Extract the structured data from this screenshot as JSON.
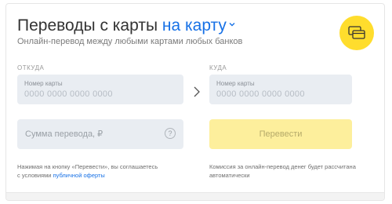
{
  "header": {
    "title_main": "Переводы с карты",
    "title_accent": "на карту",
    "subtitle": "Онлайн-перевод между любыми картами любых банков"
  },
  "icons": {
    "badge": "cards-icon",
    "dropdown": "chevron-down-icon",
    "arrow": "chevron-right-icon",
    "help": "help-icon"
  },
  "from": {
    "section_label": "ОТКУДА",
    "card_label": "Номер карты",
    "card_placeholder": "0000 0000 0000 0000"
  },
  "to": {
    "section_label": "КУДА",
    "card_label": "Номер карты",
    "card_placeholder": "0000 0000 0000 0000"
  },
  "amount": {
    "placeholder": "Сумма перевода, ₽",
    "help_glyph": "?"
  },
  "submit": {
    "label": "Перевести"
  },
  "notes": {
    "left_line1": "Нажимая на кнопку «Перевести», вы соглашаетесь",
    "left_line2_prefix": "с условиями",
    "left_link": "публичной оферты",
    "right_line1": "Комиссия за онлайн-перевод денег будет рассчитана",
    "right_line2": "автоматически"
  },
  "colors": {
    "accent": "#1771e6",
    "brand_yellow": "#ffdd2d",
    "button_disabled": "#fdef9c",
    "field_bg": "#e9edf2"
  }
}
